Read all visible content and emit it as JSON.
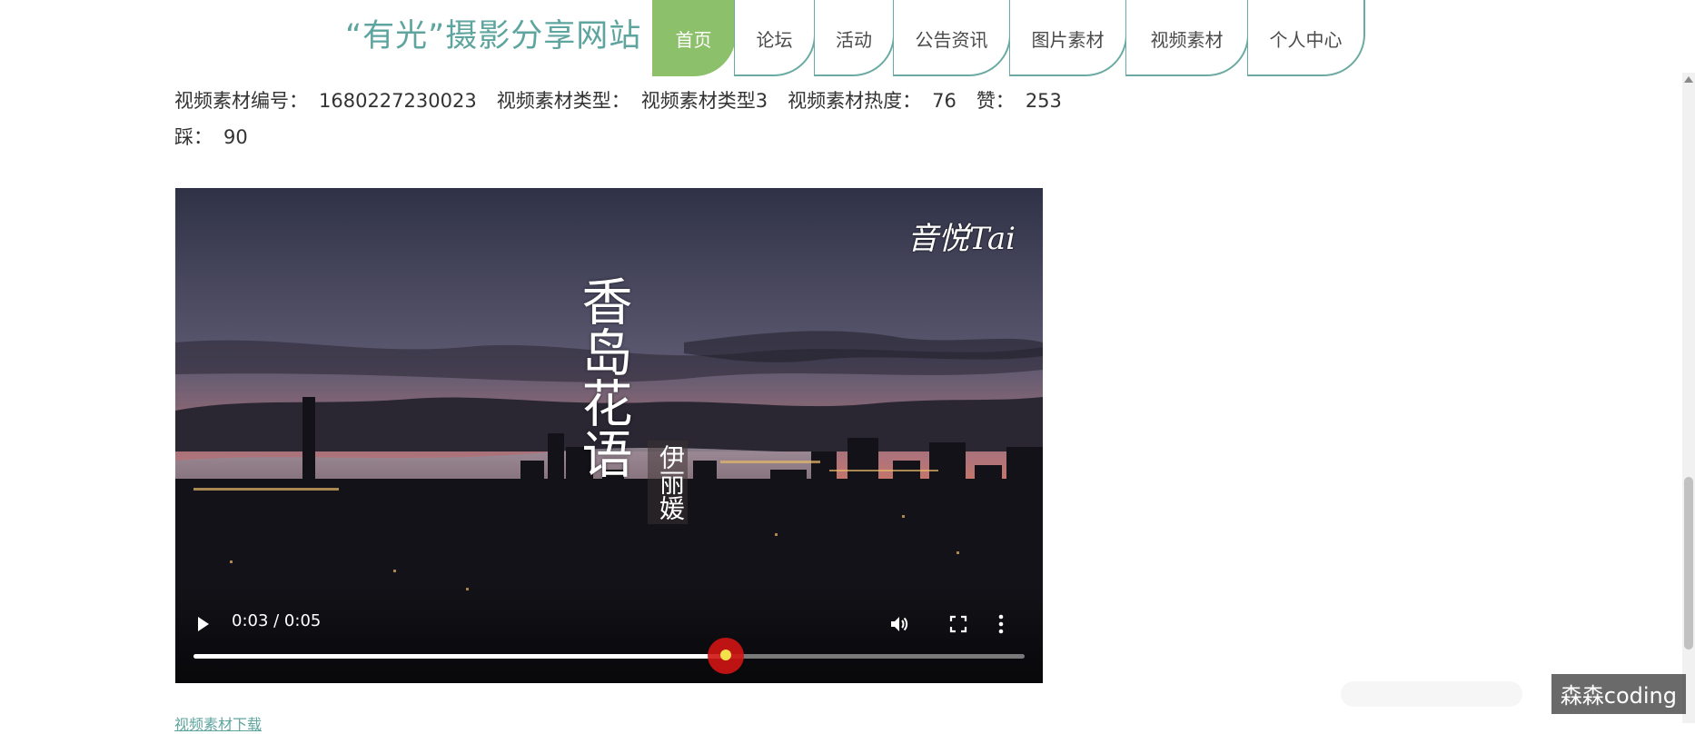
{
  "header": {
    "site_title": "“有光”摄影分享网站",
    "nav": [
      {
        "label": "首页",
        "active": true
      },
      {
        "label": "论坛",
        "active": false
      },
      {
        "label": "活动",
        "active": false
      },
      {
        "label": "公告资讯",
        "active": false
      },
      {
        "label": "图片素材",
        "active": false
      },
      {
        "label": "视频素材",
        "active": false
      },
      {
        "label": "个人中心",
        "active": false
      }
    ]
  },
  "details": {
    "number_label": "视频素材编号：",
    "number_value": "1680227230023",
    "type_label": "视频素材类型：",
    "type_value": "视频素材类型3",
    "heat_label": "视频素材热度：",
    "heat_value": "76",
    "like_label": "赞：",
    "like_value": "253",
    "dislike_label": "踩：",
    "dislike_value": "90"
  },
  "video": {
    "watermark": "音悦Tai",
    "song_title": "香岛花语",
    "singer": "伊丽媛",
    "time": "0:03 / 0:05",
    "progress": 0.64,
    "icons": [
      "play-icon",
      "volume-icon",
      "fullscreen-icon",
      "more-vertical-icon"
    ]
  },
  "download": {
    "label": "视频素材下载"
  },
  "overlay": {
    "badge": "森森coding"
  },
  "colors": {
    "brand": "#5fa59f",
    "nav_active": "#8dc06a",
    "nav_border": "#6aaaa2",
    "progress_thumb": "#d21414"
  }
}
